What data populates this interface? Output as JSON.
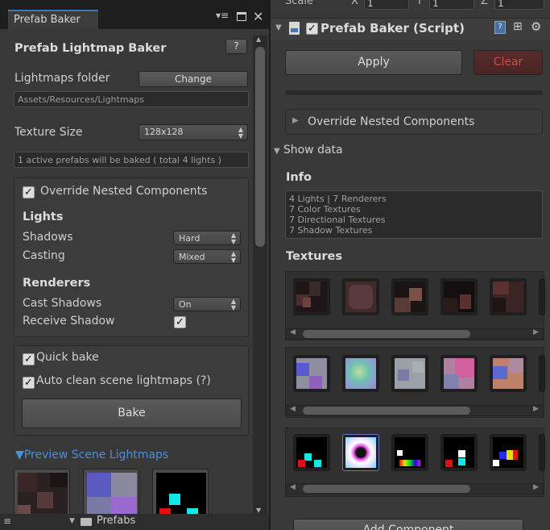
{
  "left": {
    "tab_label": "Prefab Baker",
    "menu_icon": "menu-icon",
    "maximize_icon": "maximize-icon",
    "close_icon": "close-icon",
    "title": "Prefab Lightmap Baker",
    "help_button": "?",
    "lightmaps_folder_label": "Lightmaps folder",
    "change_button": "Change",
    "folder_path": "Assets/Resources/Lightmaps",
    "texture_size_label": "Texture Size",
    "texture_size_value": "128x128",
    "info_line": "1 active prefabs will be baked ( total 4 lights )",
    "override_nested_label": "Override Nested Components",
    "override_nested_checked": true,
    "lights_header": "Lights",
    "shadows_label": "Shadows",
    "shadows_value": "Hard",
    "casting_label": "Casting",
    "casting_value": "Mixed",
    "renderers_header": "Renderers",
    "cast_shadows_label": "Cast Shadows",
    "cast_shadows_value": "On",
    "receive_shadow_label": "Receive Shadow",
    "receive_shadow_checked": true,
    "quick_bake_label": "Quick bake",
    "quick_bake_checked": true,
    "auto_clean_label": "Auto clean scene lightmaps (?)",
    "auto_clean_checked": true,
    "bake_button": "Bake",
    "preview_label": "Preview Scene Lightmaps",
    "bottom_folder_label": "Prefabs"
  },
  "right": {
    "scale_label": "Scale",
    "x_label": "X",
    "x_value": "1",
    "y_label": "Y",
    "y_value": "1",
    "z_label": "Z",
    "z_value": "1",
    "component_title": "Prefab Baker (Script)",
    "component_enabled": true,
    "apply_button": "Apply",
    "clear_button": "Clear",
    "override_nested_foldout": "Override Nested Components",
    "show_data_foldout": "Show data",
    "info_header": "Info",
    "info_lines": [
      "4 Lights |  7 Renderers",
      "7 Color Textures",
      "7 Directional Textures",
      "7 Shadow Textures"
    ],
    "textures_header": "Textures",
    "add_component_button": "Add Component"
  },
  "colors": {
    "accent": "#3a79bb",
    "link": "#4a8fe0",
    "clear_red": "#d04a4a",
    "panel": "#383838",
    "dark": "#2b2b2b"
  }
}
